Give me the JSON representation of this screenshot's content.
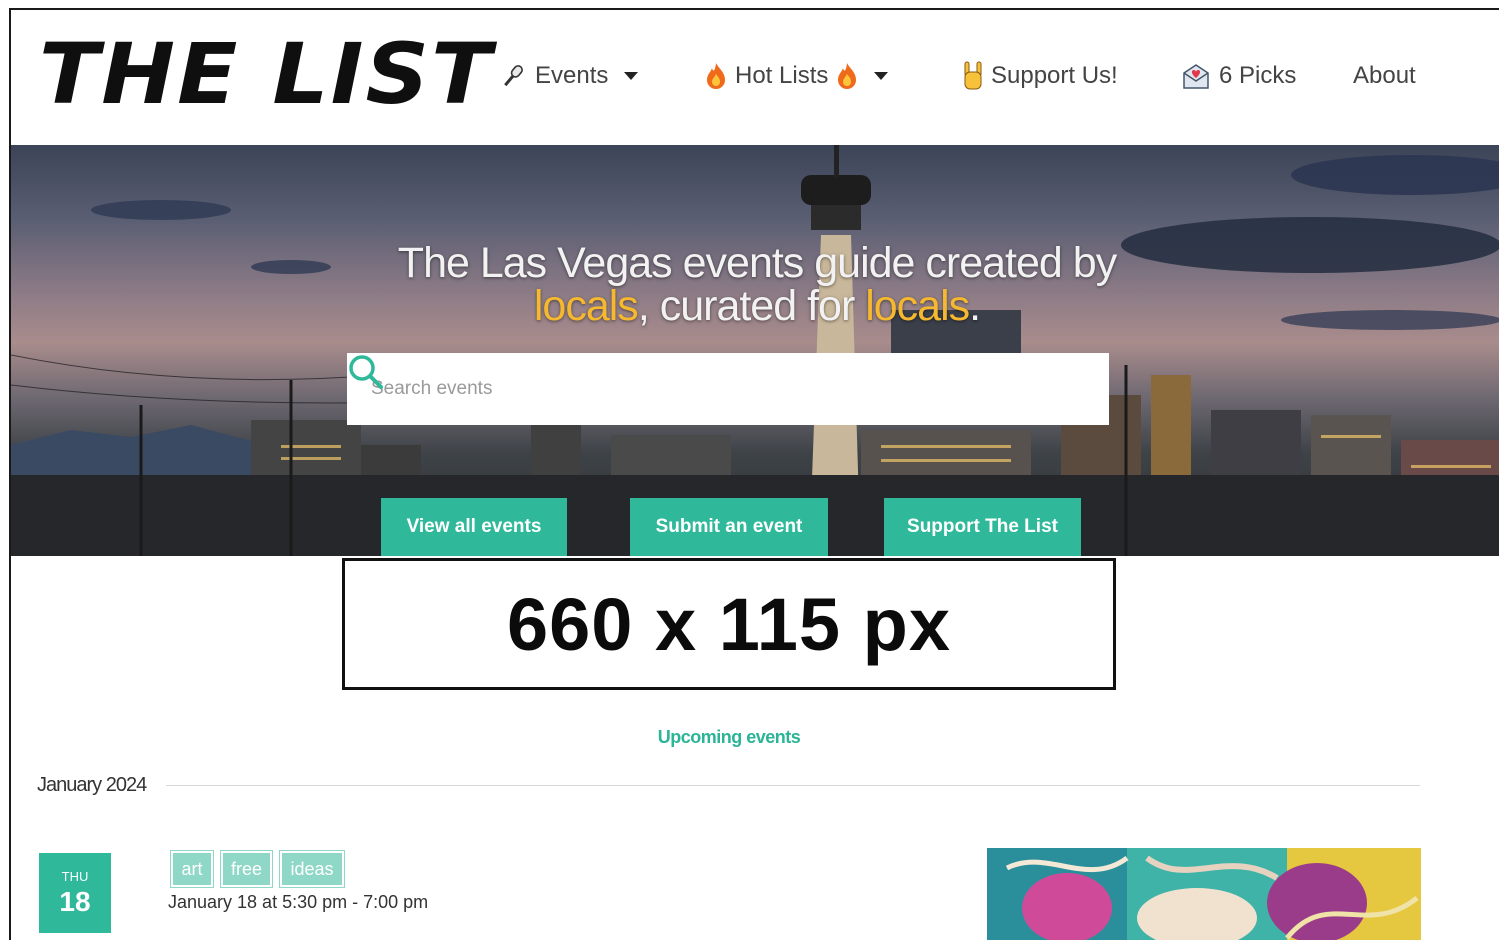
{
  "brand": {
    "logo_text": "THE LIST"
  },
  "nav": {
    "events": "Events",
    "hot_lists": "Hot Lists",
    "support": "Support Us!",
    "picks": "6 Picks",
    "about": "About"
  },
  "hero": {
    "tagline_line1": "The Las Vegas events guide created by",
    "tagline_word_locals_1": "locals",
    "tagline_middle": ", curated for ",
    "tagline_word_locals_2": "locals",
    "tagline_end": ".",
    "search_placeholder": "Search events",
    "buttons": {
      "view_all": "View all events",
      "submit": "Submit an event",
      "support": "Support The List"
    }
  },
  "ad_placeholder": "660 x 115 px",
  "events": {
    "heading": "Upcoming events",
    "month": "January 2024",
    "items": [
      {
        "dow": "THU",
        "day": "18",
        "tags": [
          "art",
          "free",
          "ideas"
        ],
        "when": "January 18 at 5:30 pm - 7:00 pm"
      }
    ]
  },
  "colors": {
    "accent_teal": "#2fb99a",
    "tag_teal": "#8fd8c7",
    "highlight_yellow": "#f5b82e"
  }
}
